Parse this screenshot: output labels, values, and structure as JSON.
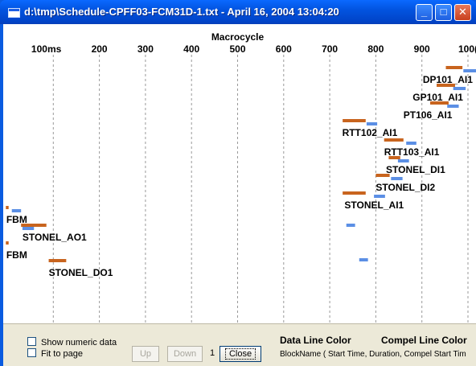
{
  "window": {
    "title": "d:\\tmp\\Schedule-CPFF03-FCM31D-1.txt - April 16, 2004 13:04:20",
    "controls": {
      "minimize": "_",
      "maximize": "□",
      "close": "✕"
    }
  },
  "chart_data": {
    "type": "gantt",
    "title": "Macrocycle",
    "x_unit": "ms",
    "xlim": [
      0,
      1000
    ],
    "x_ticks": [
      100,
      200,
      300,
      400,
      500,
      600,
      700,
      800,
      900,
      1000
    ],
    "x_tick_labels": [
      "100ms",
      "200",
      "300",
      "400",
      "500",
      "600",
      "700",
      "800",
      "900",
      "100("
    ],
    "grid": true,
    "colors": {
      "data": "#c8641e",
      "compel": "#5b8fe5"
    },
    "blocks": [
      {
        "name": "DP101_AI1",
        "data": [
          952,
          988
        ],
        "compel": [
          990,
          1020
        ],
        "label_x": 902
      },
      {
        "name": "GP101_AI1",
        "data": [
          932,
          972
        ],
        "compel": [
          968,
          995
        ],
        "label_x": 880
      },
      {
        "name": "PT106_AI1",
        "data": [
          918,
          958
        ],
        "compel": [
          955,
          980
        ],
        "label_x": 860
      },
      {
        "name": "RTT102_AI1",
        "data": [
          728,
          778
        ],
        "compel": [
          780,
          803
        ],
        "label_x": 727
      },
      {
        "name": "RTT103_AI1",
        "data": [
          818,
          860
        ],
        "compel": [
          866,
          888
        ],
        "label_x": 818
      },
      {
        "name": "STONEL_DI1",
        "data": [
          828,
          853
        ],
        "compel": [
          848,
          872
        ],
        "label_x": 822
      },
      {
        "name": "STONEL_DI2",
        "data": [
          800,
          830
        ],
        "compel": [
          833,
          858
        ],
        "label_x": 800
      },
      {
        "name": "STONEL_AI1",
        "data": [
          728,
          778
        ],
        "compel": [
          796,
          820
        ],
        "label_x": 732
      },
      {
        "name": "FBM",
        "data": [
          -3,
          3
        ],
        "compel": [
          10,
          30
        ],
        "label_x": -2
      },
      {
        "name": "STONEL_AO1",
        "data": [
          30,
          85
        ],
        "compel": [
          33,
          58
        ],
        "label_x": 33
      },
      {
        "name": "FBM",
        "data": [
          -3,
          3
        ],
        "compel": null,
        "label_x": -2
      },
      {
        "name": "STONEL_DO1",
        "data": [
          90,
          128
        ],
        "compel": null,
        "label_x": 90
      }
    ],
    "extra_compel_marks": [
      {
        "x": [
          736,
          755
        ],
        "row_y": 278
      },
      {
        "x": [
          764,
          783
        ],
        "row_y": 321
      }
    ]
  },
  "controls": {
    "show_numeric": "Show numeric data",
    "fit_to_page": "Fit to page",
    "up": "Up",
    "down": "Down",
    "page": "1",
    "close": "Close",
    "data_line_color": "Data Line Color",
    "compel_line_color": "Compel Line Color",
    "legend_hint": "BlockName ( Start Time, Duration, Compel Start Tim"
  }
}
